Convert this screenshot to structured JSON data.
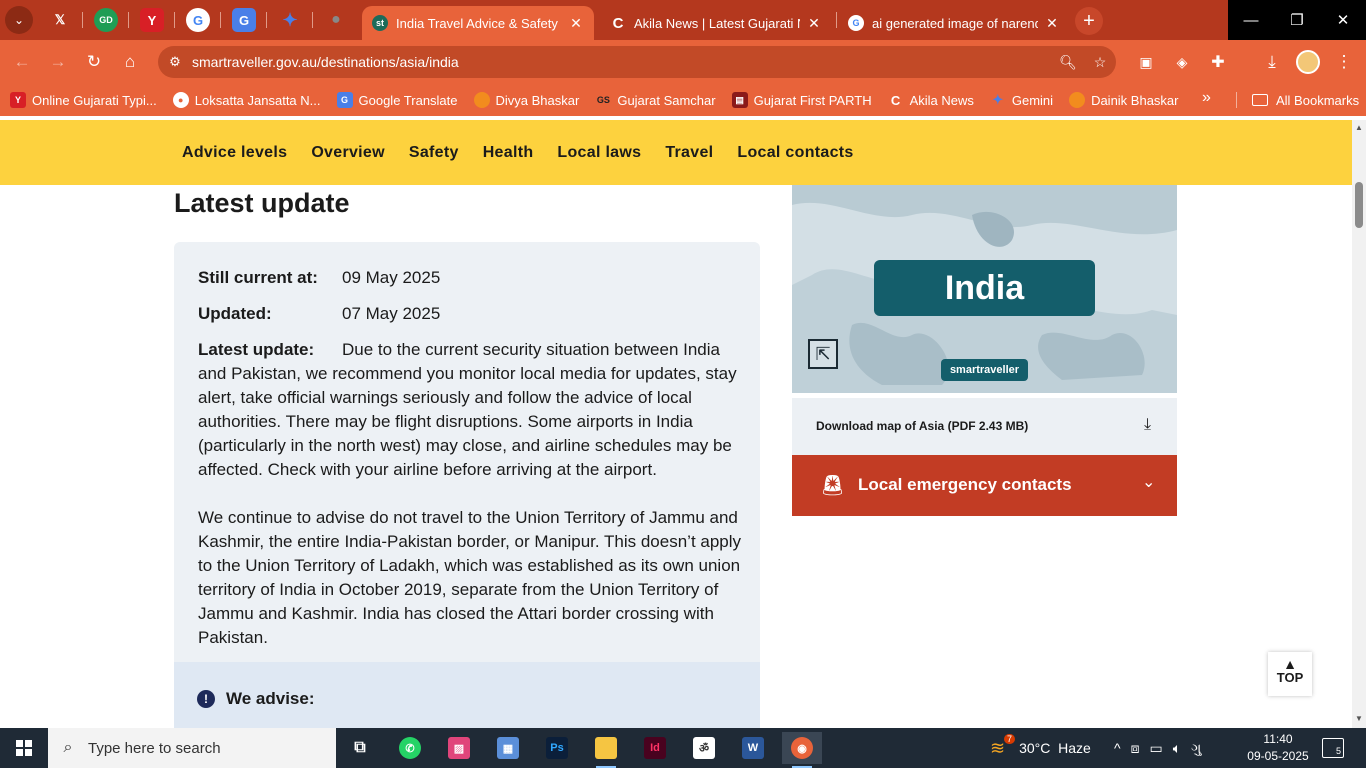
{
  "browser": {
    "pinned_tabs": [
      {
        "icon": "x-icon",
        "glyph": "𝕏",
        "color": "#000000"
      },
      {
        "icon": "gujarati-news-icon",
        "glyph": "GD",
        "color": "#1f9d55"
      },
      {
        "icon": "akila-news-icon",
        "glyph": "Y",
        "color": "#d81f26"
      },
      {
        "icon": "google-icon",
        "glyph": "G",
        "color": "#ffffff"
      },
      {
        "icon": "google-translate-icon",
        "glyph": "G",
        "color": "#4a7fe8"
      },
      {
        "icon": "gemini-icon",
        "glyph": "✦",
        "color": "#4a7fe8"
      },
      {
        "icon": "globe-icon",
        "glyph": "●",
        "color": "#666666"
      }
    ],
    "tabs": [
      {
        "title": "India Travel Advice & Safety | Sm",
        "favicon": "st",
        "active": true
      },
      {
        "title": "Akila News | Latest Gujarati New",
        "favicon": "C",
        "active": false
      },
      {
        "title": "ai generated image of narendra",
        "favicon": "G",
        "active": false
      }
    ],
    "url": "smartraveller.gov.au/destinations/asia/india",
    "bookmarks": [
      {
        "label": "Online Gujarati Typi...",
        "icon": "Y",
        "color": "#d81f26"
      },
      {
        "label": "Loksatta Jansatta N...",
        "icon": "●",
        "color": "#e8633a"
      },
      {
        "label": "Google Translate",
        "icon": "G",
        "color": "#4a7fe8"
      },
      {
        "label": "Divya Bhaskar",
        "icon": "●",
        "color": "#f28c1e"
      },
      {
        "label": "Gujarat Samchar",
        "icon": "GS",
        "color": "#222222"
      },
      {
        "label": "Gujarat First PARTH",
        "icon": "▤",
        "color": "#8b1a1a"
      },
      {
        "label": "Akila News",
        "icon": "C",
        "color": "#e8633a"
      },
      {
        "label": "Gemini",
        "icon": "✦",
        "color": "#4a7fe8"
      },
      {
        "label": "Dainik Bhaskar",
        "icon": "●",
        "color": "#f28c1e"
      }
    ],
    "all_bookmarks": "All Bookmarks"
  },
  "page": {
    "subnav": [
      "Advice levels",
      "Overview",
      "Safety",
      "Health",
      "Local laws",
      "Travel",
      "Local contacts"
    ],
    "latest_heading": "Latest update",
    "still_current_label": "Still current at:",
    "still_current_value": "09 May 2025",
    "updated_label": "Updated:",
    "updated_value": "07 May 2025",
    "latest_update_label": "Latest update:",
    "latest_update_text": "Due to the current security situation between India and Pakistan, we recommend you monitor local media for updates, stay alert, take official warnings seriously and follow the advice of local authorities. There may be flight disruptions. Some airports in India (particularly in the north west) may close, and airline schedules may be affected. Check with your airline before arriving at the airport.",
    "second_paragraph": "We continue to advise do not travel to the Union Territory of Jammu and Kashmir, the entire India-Pakistan border, or Manipur. This doesn’t apply to the Union Territory of Ladakh, which was established as its own union territory of India in October 2019, separate from the Union Territory of Jammu and Kashmir. India has closed the Attari border crossing with Pakistan.",
    "we_advise": "We advise:",
    "map_badge": "India",
    "map_brand": "smartraveller",
    "download_map": "Download map of Asia (PDF 2.43 MB)",
    "emergency": "Local emergency contacts",
    "top_button": "TOP"
  },
  "taskbar": {
    "search_placeholder": "Type here to search",
    "weather": "30°C  Haze",
    "weather_badge": "7",
    "time": "11:40",
    "date": "09-05-2025",
    "notifications": "5"
  }
}
